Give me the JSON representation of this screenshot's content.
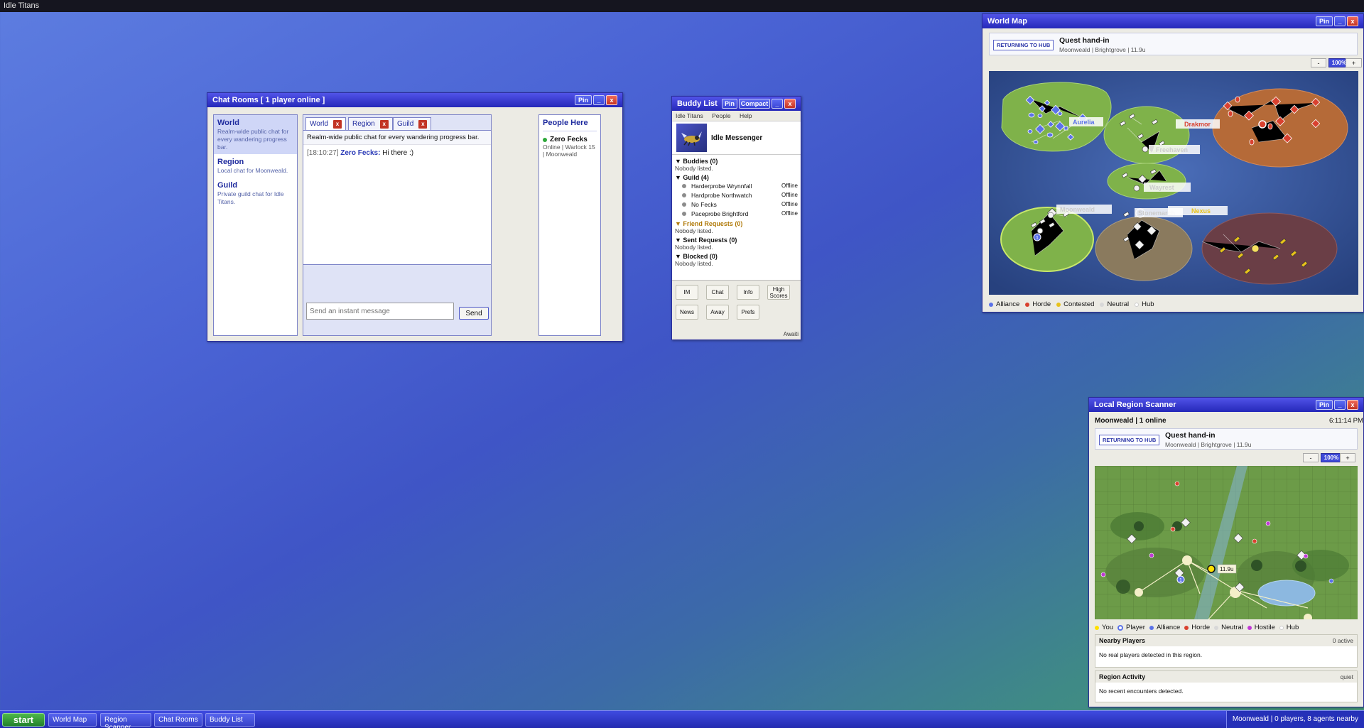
{
  "app_title": "Idle Titans",
  "chat": {
    "title": "Chat Rooms [ 1 player online ]",
    "pin": "Pin",
    "min": "_",
    "close": "x",
    "rooms": [
      {
        "name": "World",
        "desc": "Realm-wide public chat for every wandering progress bar."
      },
      {
        "name": "Region",
        "desc": "Local chat for Moonweald."
      },
      {
        "name": "Guild",
        "desc": "Private guild chat for Idle Titans."
      }
    ],
    "tabs": [
      "World",
      "Region",
      "Guild"
    ],
    "tab_close": "x",
    "topic": "Realm-wide public chat for every wandering progress bar.",
    "message": {
      "time": "[18:10:27]",
      "author": "Zero Fecks:",
      "text": "Hi there :)"
    },
    "input_placeholder": "Send an instant message",
    "send_label": "Send",
    "people_here_title": "People Here",
    "people": [
      {
        "name": "Zero Fecks",
        "detail": "Online | Warlock 15 | Moonweald"
      }
    ]
  },
  "buddy": {
    "title": "Buddy List",
    "pin": "Pin",
    "compact": "Compact",
    "min": "_",
    "close": "x",
    "menu": [
      "Idle Titans",
      "People",
      "Help"
    ],
    "messenger_name": "Idle Messenger",
    "buddies_header": "▼ Buddies (0)",
    "buddies_empty": "Nobody listed.",
    "guild_header": "▼ Guild (4)",
    "guild": [
      {
        "name": "Harderprobe Wrynnfall",
        "status": "Offline"
      },
      {
        "name": "Hardprobe Northwatch",
        "status": "Offline"
      },
      {
        "name": "No Fecks",
        "status": "Offline"
      },
      {
        "name": "Paceprobe Brightford",
        "status": "Offline"
      }
    ],
    "friend_req_header": "▼ Friend Requests (0)",
    "friend_req_empty": "Nobody listed.",
    "sent_req_header": "▼ Sent Requests (0)",
    "sent_req_empty": "Nobody listed.",
    "blocked_header": "▼ Blocked (0)",
    "blocked_empty": "Nobody listed.",
    "buttons": [
      "IM",
      "Chat",
      "Info",
      "High Scores",
      "News",
      "Away",
      "Prefs"
    ],
    "status": "Awaiti"
  },
  "worldmap": {
    "title": "World Map",
    "pin": "Pin",
    "min": "_",
    "close": "x",
    "badge": "RETURNING TO HUB",
    "quest_title": "Quest hand-in",
    "quest_sub": "Moonweald | Brightgrove | 11.9u",
    "zoom_out": "-",
    "zoom": "100%",
    "zoom_in": "+",
    "labels": [
      "Aurelia",
      "Drakmor",
      "Freehaven",
      "Wayrest",
      "Moonweald",
      "Stonemarch",
      "Nexus"
    ],
    "marker_num": "1",
    "legend": [
      "Alliance",
      "Horde",
      "Contested",
      "Neutral",
      "Hub"
    ],
    "colors": {
      "alliance": "#5b72e8",
      "horde": "#d9412f",
      "contested": "#e8c21a",
      "neutral": "#b8b8b8",
      "hub": "#f2f2f2"
    }
  },
  "scanner": {
    "title": "Local Region Scanner",
    "pin": "Pin",
    "min": "_",
    "close": "x",
    "region_status": "Moonweald | 1 online",
    "time": "6:11:14 PM",
    "badge": "RETURNING TO HUB",
    "quest_title": "Quest hand-in",
    "quest_sub": "Moonweald | Brightgrove | 11.9u",
    "zoom_out": "-",
    "zoom": "100%",
    "zoom_in": "+",
    "distance_label": "11.9u",
    "marker_num": "1",
    "legend": [
      "You",
      "Player",
      "Alliance",
      "Horde",
      "Neutral",
      "Hostile",
      "Hub"
    ],
    "nearby_title": "Nearby Players",
    "nearby_count": "0 active",
    "nearby_text": "No real players detected in this region.",
    "activity_title": "Region Activity",
    "activity_state": "quiet",
    "activity_text": "No recent encounters detected."
  },
  "taskbar": {
    "start": "start",
    "tasks": [
      "World Map",
      "Region Scanner",
      "Chat Rooms",
      "Buddy List"
    ],
    "status": "Moonweald | 0 players, 8 agents nearby"
  }
}
